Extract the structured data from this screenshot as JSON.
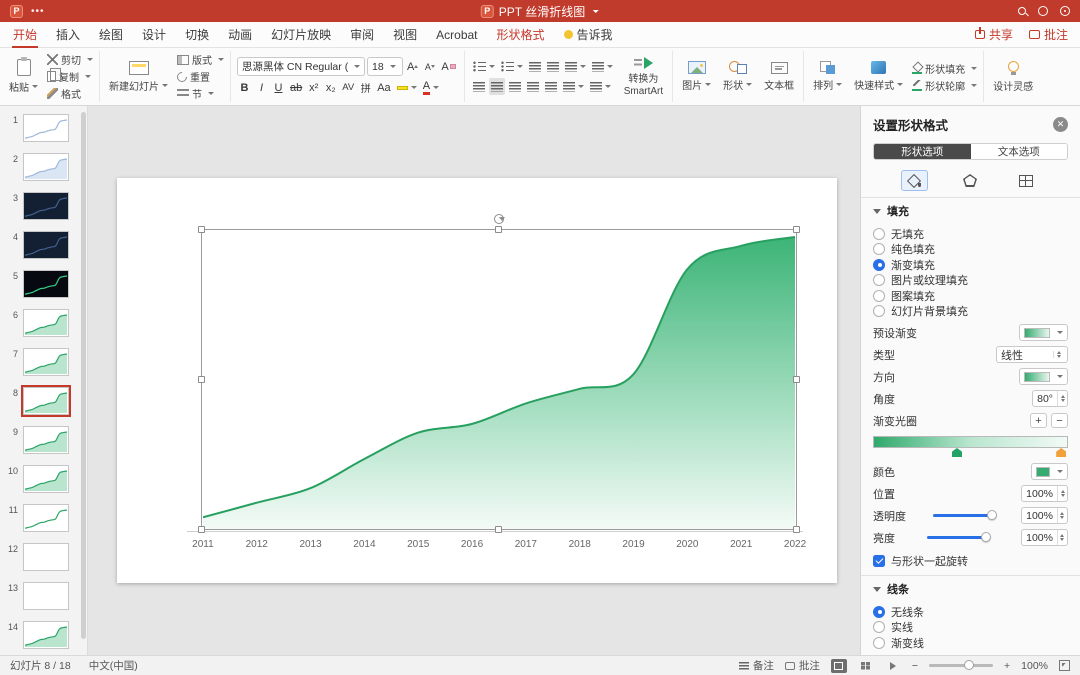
{
  "colors": {
    "titlebar": "#c13b2d",
    "accent_blue": "#2970e8",
    "chart_green": "#27a05f",
    "selection_red": "#c5392b"
  },
  "titlebar": {
    "logo_letter": "P",
    "window_menu": "•••",
    "title": "PPT 丝滑折线图"
  },
  "tabbar": {
    "tabs": [
      {
        "id": "home",
        "label": "开始",
        "state": "active"
      },
      {
        "id": "insert",
        "label": "插入",
        "state": "normal"
      },
      {
        "id": "draw",
        "label": "绘图",
        "state": "normal"
      },
      {
        "id": "design",
        "label": "设计",
        "state": "normal"
      },
      {
        "id": "transitions",
        "label": "切换",
        "state": "normal"
      },
      {
        "id": "animations",
        "label": "动画",
        "state": "normal"
      },
      {
        "id": "slideshow",
        "label": "幻灯片放映",
        "state": "normal"
      },
      {
        "id": "review",
        "label": "审阅",
        "state": "normal"
      },
      {
        "id": "view",
        "label": "视图",
        "state": "normal"
      },
      {
        "id": "acrobat",
        "label": "Acrobat",
        "state": "normal"
      },
      {
        "id": "shape-format",
        "label": "形状格式",
        "state": "contextual"
      },
      {
        "id": "tellme",
        "label": "告诉我",
        "state": "tellme"
      }
    ],
    "share": "共享",
    "comments": "批注"
  },
  "ribbon": {
    "paste": "粘贴",
    "cut": "剪切",
    "copy": "复制",
    "format_painter": "格式",
    "new_slide": "新建幻灯片",
    "layout": "版式",
    "reset": "重置",
    "section": "节",
    "font_name": "思源黑体 CN Regular (正...",
    "font_size": "18",
    "font_grow_letter": "A",
    "font_shrink_letter": "A",
    "clear_letter": "A",
    "bold": "B",
    "italic": "I",
    "underline": "U",
    "strikethrough": "ab",
    "superscript": "x²",
    "subscript": "x₂",
    "char_spacing": "AV",
    "phonetic": "拼",
    "change_case": "Aa",
    "font_color_letter": "A",
    "smartart_line1": "转换为",
    "smartart_line2": "SmartArt",
    "picture": "图片",
    "shapes": "形状",
    "textbox": "文本框",
    "arrange": "排列",
    "quick_styles": "快速样式",
    "shape_fill": "形状填充",
    "shape_outline": "形状轮廓",
    "design_ideas": "设计灵感"
  },
  "slides_panel": {
    "selected": 8,
    "items": [
      {
        "number": 1,
        "variant": "line-blue"
      },
      {
        "number": 2,
        "variant": "area-blue"
      },
      {
        "number": 3,
        "variant": "dark"
      },
      {
        "number": 4,
        "variant": "dark"
      },
      {
        "number": 5,
        "variant": "dark-green"
      },
      {
        "number": 6,
        "variant": "area-green"
      },
      {
        "number": 7,
        "variant": "area-green"
      },
      {
        "number": 8,
        "variant": "area-green"
      },
      {
        "number": 9,
        "variant": "area-green"
      },
      {
        "number": 10,
        "variant": "area-green"
      },
      {
        "number": 11,
        "variant": "line-green"
      },
      {
        "number": 12,
        "variant": "blank"
      },
      {
        "number": 13,
        "variant": "blank"
      },
      {
        "number": 14,
        "variant": "area-green"
      }
    ]
  },
  "chart_data": {
    "type": "area",
    "categories": [
      "2011",
      "2012",
      "2013",
      "2014",
      "2015",
      "2016",
      "2017",
      "2018",
      "2019",
      "2020",
      "2021",
      "2022"
    ],
    "values": [
      4,
      9,
      14,
      24,
      33,
      36,
      43,
      48,
      53,
      89,
      97,
      100
    ],
    "title": "",
    "xlabel": "",
    "ylabel": "",
    "ylim": [
      0,
      100
    ],
    "grid": false,
    "legend": "none",
    "fill_gradient_top": "#3cb477",
    "fill_gradient_mid": "#9fdcbd",
    "fill_gradient_bottom": "#f4fbf7",
    "line_color": "#27a05f"
  },
  "format_panel": {
    "title": "设置形状格式",
    "close": "✕",
    "tabs": [
      {
        "id": "shape-options",
        "label": "形状选项",
        "active": true
      },
      {
        "id": "text-options",
        "label": "文本选项",
        "active": false
      }
    ],
    "fill": {
      "title": "填充",
      "options": [
        {
          "id": "no-fill",
          "label": "无填充",
          "selected": false
        },
        {
          "id": "solid-fill",
          "label": "纯色填充",
          "selected": false
        },
        {
          "id": "gradient-fill",
          "label": "渐变填充",
          "selected": true
        },
        {
          "id": "picture-texture-fill",
          "label": "图片或纹理填充",
          "selected": false
        },
        {
          "id": "pattern-fill",
          "label": "图案填充",
          "selected": false
        },
        {
          "id": "slide-background-fill",
          "label": "幻灯片背景填充",
          "selected": false
        }
      ],
      "preset_label": "预设渐变",
      "type_label": "类型",
      "type_value": "线性",
      "direction_label": "方向",
      "angle_label": "角度",
      "angle_value": "80°",
      "stops_label": "渐变光圈",
      "add": "+",
      "remove": "−",
      "color_label": "颜色",
      "position_label": "位置",
      "position_value": "100%",
      "transparency_label": "透明度",
      "transparency_value": "100%",
      "brightness_label": "亮度",
      "brightness_value": "100%",
      "rotate_with_shape": "与形状一起旋转"
    },
    "line": {
      "title": "线条",
      "options": [
        {
          "id": "no-line",
          "label": "无线条",
          "selected": true
        },
        {
          "id": "solid-line",
          "label": "实线",
          "selected": false
        },
        {
          "id": "gradient-line",
          "label": "渐变线",
          "selected": false
        }
      ]
    }
  },
  "statusbar": {
    "slide_info": "幻灯片 8 / 18",
    "language": "中文(中国)",
    "notes": "备注",
    "comments": "批注",
    "zoom_out": "−",
    "zoom_in": "+",
    "zoom": "100%"
  }
}
